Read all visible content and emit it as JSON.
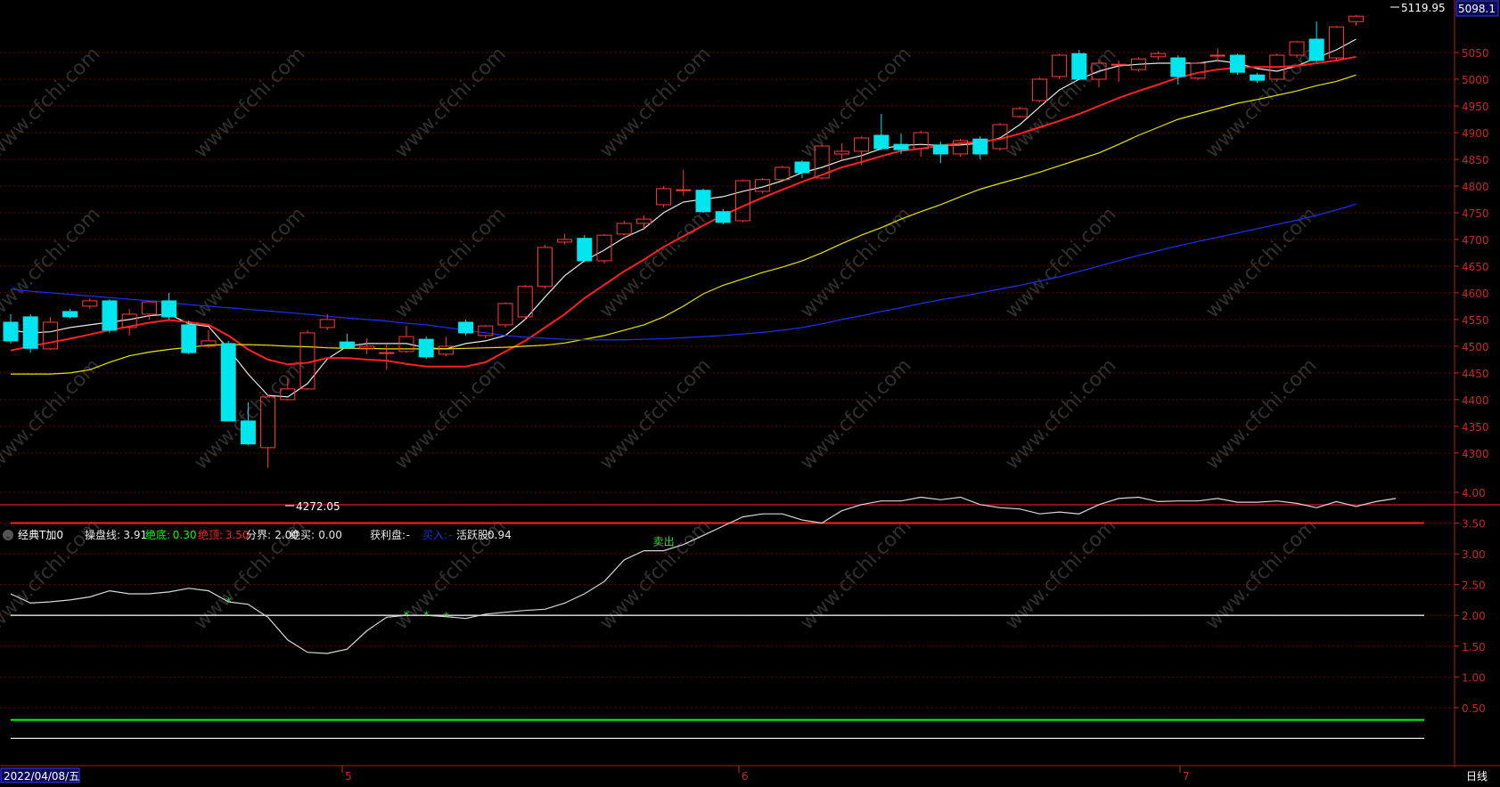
{
  "colors": {
    "bg": "#000000",
    "grid": "#7a0000",
    "axis_text": "#c42a2a",
    "up": "#ff3b3b",
    "down": "#00e5ee",
    "ma5": "#e8e8e8",
    "ma10": "#ff2020",
    "ma20": "#e6e600",
    "ma60": "#1a2ee6",
    "indicator_line": "#d8d8d8",
    "level_red": "#ff2020",
    "level_white": "#e8e8e8",
    "level_green": "#00ff00",
    "buy_star": "#3cdc3c",
    "sell_text": "#3cdc3c",
    "watermark": "#404040"
  },
  "price_axis": {
    "ticks": [
      "5050",
      "5000",
      "4950",
      "4900",
      "4850",
      "4800",
      "4750",
      "4700",
      "4650",
      "4600",
      "4550",
      "4500",
      "4450",
      "4400",
      "4350",
      "4300"
    ],
    "current_label": "5098.1"
  },
  "indicator_axis": {
    "ticks": [
      "4.00",
      "3.50",
      "3.00",
      "2.50",
      "2.00",
      "1.50",
      "1.00",
      "0.50"
    ]
  },
  "annotations": {
    "high_label": "5119.95",
    "low_label": "4272.05",
    "sell_label": "卖出"
  },
  "indicator_header": {
    "name": "经典T加0",
    "items": [
      {
        "label": "操盘线:",
        "value": "3.91",
        "color": "#e8e8e8"
      },
      {
        "label": "绝底:",
        "value": "0.30",
        "color": "#00ff00"
      },
      {
        "label": "绝顶:",
        "value": "3.50",
        "color": "#ff2020"
      },
      {
        "label": "分界:",
        "value": "2.00",
        "color": "#e8e8e8"
      },
      {
        "label": "绝买:",
        "value": "0.00",
        "color": "#e8e8e8"
      },
      {
        "label": "获利盘:",
        "value": "-",
        "color": "#e8e8e8"
      },
      {
        "label": "买入:",
        "value": "-",
        "color": "#1a2ee6"
      },
      {
        "label": "活跃股:",
        "value": "0.94",
        "color": "#e8e8e8"
      }
    ]
  },
  "time_axis": {
    "start_date": "2022/04/08/五",
    "month_labels": [
      "5",
      "6",
      "7"
    ],
    "period": "日线"
  },
  "watermark_text": "www.cfchi.com",
  "chart_data": [
    {
      "type": "candlestick",
      "ylim": [
        4250,
        5130
      ],
      "candles": [
        {
          "o": 4545,
          "c": 4510,
          "h": 4560,
          "l": 4505
        },
        {
          "o": 4555,
          "c": 4496,
          "h": 4560,
          "l": 4488
        },
        {
          "o": 4495,
          "c": 4545,
          "h": 4555,
          "l": 4493
        },
        {
          "o": 4565,
          "c": 4555,
          "h": 4570,
          "l": 4552
        },
        {
          "o": 4575,
          "c": 4585,
          "h": 4590,
          "l": 4570
        },
        {
          "o": 4585,
          "c": 4530,
          "h": 4588,
          "l": 4525
        },
        {
          "o": 4535,
          "c": 4560,
          "h": 4570,
          "l": 4520
        },
        {
          "o": 4560,
          "c": 4583,
          "h": 4585,
          "l": 4550
        },
        {
          "o": 4585,
          "c": 4555,
          "h": 4600,
          "l": 4550
        },
        {
          "o": 4540,
          "c": 4488,
          "h": 4548,
          "l": 4485
        },
        {
          "o": 4500,
          "c": 4510,
          "h": 4530,
          "l": 4497
        },
        {
          "o": 4505,
          "c": 4360,
          "h": 4510,
          "l": 4360
        },
        {
          "o": 4360,
          "c": 4317,
          "h": 4395,
          "l": 4315
        },
        {
          "o": 4310,
          "c": 4405,
          "h": 4410,
          "l": 4272
        },
        {
          "o": 4400,
          "c": 4420,
          "h": 4440,
          "l": 4398
        },
        {
          "o": 4420,
          "c": 4525,
          "h": 4530,
          "l": 4418
        },
        {
          "o": 4535,
          "c": 4550,
          "h": 4560,
          "l": 4530
        },
        {
          "o": 4508,
          "c": 4497,
          "h": 4523,
          "l": 4495
        },
        {
          "o": 4495,
          "c": 4500,
          "h": 4515,
          "l": 4485
        },
        {
          "o": 4488,
          "c": 4488,
          "h": 4503,
          "l": 4456
        },
        {
          "o": 4490,
          "c": 4518,
          "h": 4538,
          "l": 4488
        },
        {
          "o": 4513,
          "c": 4480,
          "h": 4518,
          "l": 4476
        },
        {
          "o": 4485,
          "c": 4500,
          "h": 4518,
          "l": 4481
        },
        {
          "o": 4545,
          "c": 4525,
          "h": 4550,
          "l": 4520
        },
        {
          "o": 4520,
          "c": 4538,
          "h": 4540,
          "l": 4515
        },
        {
          "o": 4540,
          "c": 4580,
          "h": 4582,
          "l": 4535
        },
        {
          "o": 4555,
          "c": 4612,
          "h": 4615,
          "l": 4550
        },
        {
          "o": 4612,
          "c": 4685,
          "h": 4690,
          "l": 4608
        },
        {
          "o": 4695,
          "c": 4700,
          "h": 4710,
          "l": 4690
        },
        {
          "o": 4702,
          "c": 4660,
          "h": 4708,
          "l": 4657
        },
        {
          "o": 4660,
          "c": 4708,
          "h": 4710,
          "l": 4655
        },
        {
          "o": 4710,
          "c": 4730,
          "h": 4735,
          "l": 4708
        },
        {
          "o": 4730,
          "c": 4738,
          "h": 4745,
          "l": 4720
        },
        {
          "o": 4765,
          "c": 4795,
          "h": 4800,
          "l": 4760
        },
        {
          "o": 4793,
          "c": 4793,
          "h": 4830,
          "l": 4782
        },
        {
          "o": 4792,
          "c": 4752,
          "h": 4795,
          "l": 4750
        },
        {
          "o": 4752,
          "c": 4732,
          "h": 4757,
          "l": 4728
        },
        {
          "o": 4735,
          "c": 4810,
          "h": 4812,
          "l": 4732
        },
        {
          "o": 4790,
          "c": 4812,
          "h": 4815,
          "l": 4786
        },
        {
          "o": 4812,
          "c": 4835,
          "h": 4838,
          "l": 4810
        },
        {
          "o": 4845,
          "c": 4825,
          "h": 4848,
          "l": 4815
        },
        {
          "o": 4815,
          "c": 4875,
          "h": 4878,
          "l": 4812
        },
        {
          "o": 4860,
          "c": 4865,
          "h": 4880,
          "l": 4850
        },
        {
          "o": 4865,
          "c": 4890,
          "h": 4893,
          "l": 4840
        },
        {
          "o": 4895,
          "c": 4870,
          "h": 4935,
          "l": 4867
        },
        {
          "o": 4878,
          "c": 4868,
          "h": 4898,
          "l": 4860
        },
        {
          "o": 4870,
          "c": 4900,
          "h": 4903,
          "l": 4855
        },
        {
          "o": 4877,
          "c": 4860,
          "h": 4883,
          "l": 4843
        },
        {
          "o": 4860,
          "c": 4885,
          "h": 4888,
          "l": 4855
        },
        {
          "o": 4888,
          "c": 4860,
          "h": 4893,
          "l": 4850
        },
        {
          "o": 4870,
          "c": 4915,
          "h": 4918,
          "l": 4866
        },
        {
          "o": 4930,
          "c": 4945,
          "h": 4948,
          "l": 4928
        },
        {
          "o": 4960,
          "c": 5000,
          "h": 5003,
          "l": 4957
        },
        {
          "o": 5005,
          "c": 5045,
          "h": 5048,
          "l": 5000
        },
        {
          "o": 5048,
          "c": 5000,
          "h": 5055,
          "l": 4998
        },
        {
          "o": 5000,
          "c": 5030,
          "h": 5035,
          "l": 4985
        },
        {
          "o": 5028,
          "c": 5028,
          "h": 5035,
          "l": 4995
        },
        {
          "o": 5018,
          "c": 5038,
          "h": 5042,
          "l": 5014
        },
        {
          "o": 5042,
          "c": 5048,
          "h": 5052,
          "l": 5036
        },
        {
          "o": 5040,
          "c": 5005,
          "h": 5045,
          "l": 4990
        },
        {
          "o": 5002,
          "c": 5030,
          "h": 5033,
          "l": 4998
        },
        {
          "o": 5045,
          "c": 5045,
          "h": 5058,
          "l": 5032
        },
        {
          "o": 5045,
          "c": 5013,
          "h": 5048,
          "l": 5008
        },
        {
          "o": 5008,
          "c": 4998,
          "h": 5012,
          "l": 4993
        },
        {
          "o": 5000,
          "c": 5045,
          "h": 5048,
          "l": 4995
        },
        {
          "o": 5045,
          "c": 5070,
          "h": 5072,
          "l": 5040
        },
        {
          "o": 5075,
          "c": 5035,
          "h": 5108,
          "l": 5032
        },
        {
          "o": 5040,
          "c": 5098,
          "h": 5100,
          "l": 5035
        },
        {
          "o": 5108,
          "c": 5118,
          "h": 5120,
          "l": 5100
        }
      ],
      "ma_series": [
        {
          "name": "MA5",
          "color": "#e8e8e8",
          "start": 0,
          "values": [
            4530,
            4525,
            4527,
            4535,
            4540,
            4545,
            4550,
            4557,
            4560,
            4542,
            4537,
            4495,
            4448,
            4408,
            4405,
            4430,
            4476,
            4500,
            4505,
            4505,
            4505,
            4497,
            4495,
            4505,
            4510,
            4520,
            4550,
            4592,
            4632,
            4660,
            4680,
            4703,
            4720,
            4750,
            4770,
            4775,
            4780,
            4790,
            4798,
            4810,
            4825,
            4835,
            4848,
            4857,
            4870,
            4876,
            4878,
            4876,
            4877,
            4880,
            4890,
            4915,
            4948,
            4980,
            5000,
            5015,
            5025,
            5028,
            5030,
            5030,
            5030,
            5035,
            5030,
            5020,
            5015,
            5025,
            5040,
            5055,
            5075
          ]
        },
        {
          "name": "MA10",
          "color": "#ff2020",
          "start": 0,
          "values": [
            4492,
            4500,
            4507,
            4514,
            4522,
            4530,
            4537,
            4544,
            4549,
            4545,
            4540,
            4520,
            4494,
            4475,
            4466,
            4469,
            4478,
            4478,
            4475,
            4473,
            4467,
            4462,
            4462,
            4462,
            4470,
            4490,
            4510,
            4535,
            4560,
            4590,
            4615,
            4640,
            4662,
            4686,
            4706,
            4726,
            4745,
            4762,
            4778,
            4793,
            4808,
            4821,
            4835,
            4845,
            4856,
            4866,
            4870,
            4876,
            4880,
            4883,
            4888,
            4898,
            4910,
            4922,
            4935,
            4950,
            4965,
            4978,
            4990,
            5003,
            5012,
            5018,
            5022,
            5023,
            5023,
            5025,
            5030,
            5035,
            5042
          ]
        },
        {
          "name": "MA20",
          "color": "#e6e600",
          "start": 0,
          "values": [
            4448,
            4448,
            4448,
            4450,
            4456,
            4470,
            4482,
            4489,
            4494,
            4498,
            4502,
            4503,
            4503,
            4502,
            4500,
            4499,
            4497,
            4496,
            4496,
            4495,
            4495,
            4495,
            4495,
            4496,
            4497,
            4498,
            4500,
            4502,
            4506,
            4513,
            4520,
            4530,
            4540,
            4555,
            4575,
            4598,
            4614,
            4626,
            4638,
            4648,
            4660,
            4675,
            4692,
            4708,
            4722,
            4738,
            4752,
            4765,
            4780,
            4794,
            4805,
            4815,
            4826,
            4838,
            4850,
            4862,
            4878,
            4895,
            4910,
            4925,
            4935,
            4945,
            4955,
            4962,
            4970,
            4978,
            4988,
            4996,
            5008
          ]
        },
        {
          "name": "MA60",
          "color": "#1a2ee6",
          "start": 0,
          "values": [
            4607,
            4603,
            4600,
            4597,
            4594,
            4591,
            4588,
            4585,
            4582,
            4578,
            4575,
            4572,
            4569,
            4566,
            4563,
            4560,
            4556,
            4553,
            4550,
            4547,
            4543,
            4540,
            4535,
            4530,
            4525,
            4520,
            4517,
            4515,
            4513,
            4512,
            4512,
            4512,
            4513,
            4514,
            4516,
            4518,
            4520,
            4523,
            4526,
            4530,
            4535,
            4542,
            4550,
            4557,
            4565,
            4572,
            4580,
            4587,
            4593,
            4600,
            4607,
            4614,
            4622,
            4630,
            4640,
            4650,
            4660,
            4670,
            4679,
            4688,
            4696,
            4704,
            4712,
            4720,
            4728,
            4736,
            4745,
            4755,
            4766
          ]
        }
      ]
    },
    {
      "type": "line",
      "name": "操盘线",
      "ylim": [
        0,
        4.3
      ],
      "values": [
        2.35,
        2.2,
        2.22,
        2.25,
        2.3,
        2.4,
        2.35,
        2.35,
        2.38,
        2.44,
        2.4,
        2.22,
        2.18,
        1.97,
        1.6,
        1.4,
        1.38,
        1.45,
        1.75,
        1.97,
        2.0,
        2.0,
        1.98,
        1.95,
        2.02,
        2.05,
        2.08,
        2.1,
        2.2,
        2.35,
        2.55,
        2.9,
        3.05,
        3.05,
        3.15,
        3.3,
        3.45,
        3.6,
        3.65,
        3.65,
        3.55,
        3.5,
        3.7,
        3.8,
        3.86,
        3.86,
        3.92,
        3.88,
        3.92,
        3.8,
        3.75,
        3.73,
        3.65,
        3.68,
        3.65,
        3.8,
        3.9,
        3.92,
        3.85,
        3.86,
        3.86,
        3.9,
        3.84,
        3.84,
        3.86,
        3.82,
        3.75,
        3.85,
        3.77,
        3.85,
        3.9
      ],
      "levels": [
        {
          "name": "绝顶",
          "value": 3.5
        },
        {
          "name": "分界",
          "value": 2.0
        },
        {
          "name": "绝底",
          "value": 0.3
        },
        {
          "name": "绝买",
          "value": 0.0
        }
      ],
      "buy_markers": [
        11,
        20,
        21,
        22
      ],
      "sell_marker": 33
    }
  ]
}
